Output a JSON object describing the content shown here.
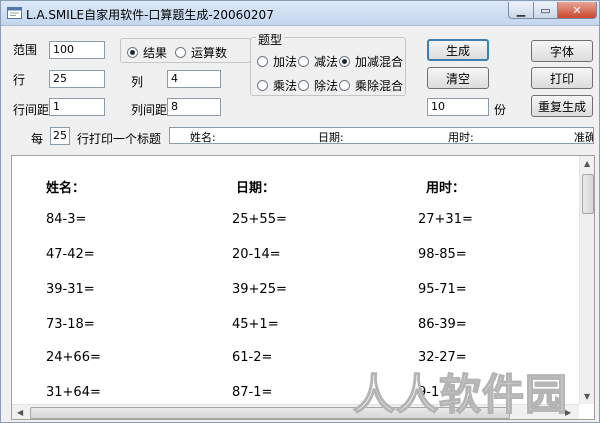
{
  "window": {
    "title": "L.A.SMILE自家用软件-口算题生成-20060207"
  },
  "settings": {
    "range_label": "范围",
    "range_value": "100",
    "rows_label": "行",
    "rows_value": "25",
    "cols_label": "列",
    "cols_value": "4",
    "row_spacing_label": "行间距",
    "row_spacing_value": "1",
    "col_spacing_label": "列间距",
    "col_spacing_value": "8",
    "every_label": "每",
    "every_value": "25",
    "every_suffix": "行打印一个标题",
    "copies_value": "10",
    "copies_label": "份"
  },
  "answer_mode": {
    "options": [
      "结果",
      "运算数"
    ],
    "selected": "结果"
  },
  "question_type": {
    "title": "题型",
    "options": [
      "加法",
      "减法",
      "加减混合",
      "乘法",
      "除法",
      "乘除混合"
    ],
    "selected": "加减混合"
  },
  "buttons": {
    "generate": "生成",
    "clear": "清空",
    "font": "字体",
    "print": "打印",
    "regenerate": "重复生成"
  },
  "header_strip": {
    "name": "姓名:",
    "date": "日期:",
    "time": "用时:",
    "extra": "准确"
  },
  "sheet": {
    "headers": [
      "姓名：",
      "日期：",
      "用时："
    ],
    "columns": [
      [
        "84-3=",
        "47-42=",
        "39-31=",
        "73-18=",
        "24+66=",
        "31+64="
      ],
      [
        "25+55=",
        "20-14=",
        "39+25=",
        "45+1=",
        "61-2=",
        "87-1="
      ],
      [
        "27+31=",
        "98-85=",
        "95-71=",
        "86-39=",
        "32-27=",
        "9-1"
      ]
    ]
  },
  "watermark": "人人软件园"
}
